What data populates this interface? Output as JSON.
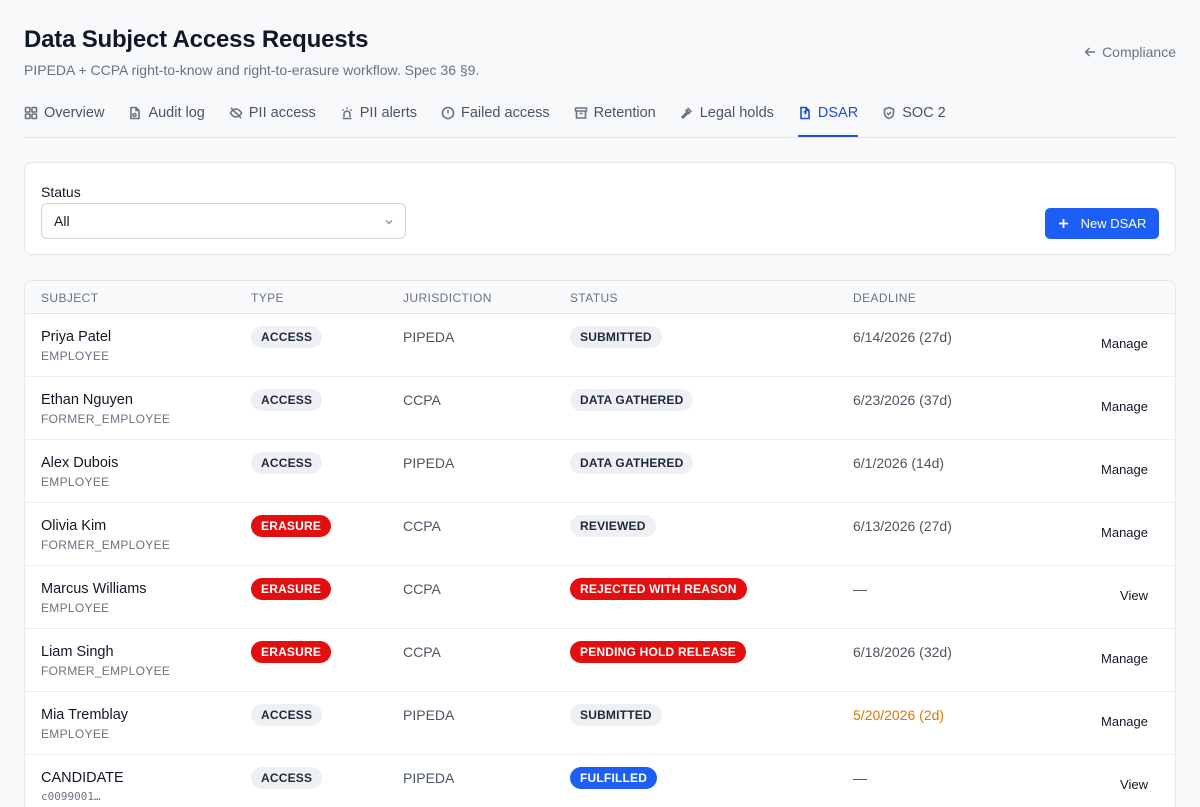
{
  "header": {
    "title": "Data Subject Access Requests",
    "subtitle": "PIPEDA + CCPA right-to-know and right-to-erasure workflow. Spec 36 §9.",
    "back_label": "Compliance"
  },
  "tabs": [
    {
      "label": "Overview",
      "icon": "grid-icon"
    },
    {
      "label": "Audit log",
      "icon": "file-icon"
    },
    {
      "label": "PII access",
      "icon": "eye-off-icon"
    },
    {
      "label": "PII alerts",
      "icon": "siren-icon"
    },
    {
      "label": "Failed access",
      "icon": "alert-circle-icon"
    },
    {
      "label": "Retention",
      "icon": "archive-icon"
    },
    {
      "label": "Legal holds",
      "icon": "gavel-icon"
    },
    {
      "label": "DSAR",
      "icon": "document-icon"
    },
    {
      "label": "SOC 2",
      "icon": "shield-icon"
    }
  ],
  "active_tab": "DSAR",
  "filter": {
    "status_label": "Status",
    "status_value": "All",
    "new_button": "New DSAR"
  },
  "table": {
    "columns": [
      "SUBJECT",
      "TYPE",
      "JURISDICTION",
      "STATUS",
      "DEADLINE"
    ],
    "rows": [
      {
        "name": "Priya Patel",
        "kind": "EMPLOYEE",
        "type": "ACCESS",
        "jurisdiction": "PIPEDA",
        "status": "SUBMITTED",
        "deadline": "6/14/2026 (27d)",
        "action": "Manage"
      },
      {
        "name": "Ethan Nguyen",
        "kind": "FORMER_EMPLOYEE",
        "type": "ACCESS",
        "jurisdiction": "CCPA",
        "status": "DATA GATHERED",
        "deadline": "6/23/2026 (37d)",
        "action": "Manage"
      },
      {
        "name": "Alex Dubois",
        "kind": "EMPLOYEE",
        "type": "ACCESS",
        "jurisdiction": "PIPEDA",
        "status": "DATA GATHERED",
        "deadline": "6/1/2026 (14d)",
        "action": "Manage"
      },
      {
        "name": "Olivia Kim",
        "kind": "FORMER_EMPLOYEE",
        "type": "ERASURE",
        "jurisdiction": "CCPA",
        "status": "REVIEWED",
        "deadline": "6/13/2026 (27d)",
        "action": "Manage"
      },
      {
        "name": "Marcus Williams",
        "kind": "EMPLOYEE",
        "type": "ERASURE",
        "jurisdiction": "CCPA",
        "status": "REJECTED WITH REASON",
        "deadline": "—",
        "action": "View"
      },
      {
        "name": "Liam Singh",
        "kind": "FORMER_EMPLOYEE",
        "type": "ERASURE",
        "jurisdiction": "CCPA",
        "status": "PENDING HOLD RELEASE",
        "deadline": "6/18/2026 (32d)",
        "action": "Manage"
      },
      {
        "name": "Mia Tremblay",
        "kind": "EMPLOYEE",
        "type": "ACCESS",
        "jurisdiction": "PIPEDA",
        "status": "SUBMITTED",
        "deadline": "5/20/2026 (2d)",
        "action": "Manage"
      },
      {
        "name": "CANDIDATE",
        "kind": "c0099001…",
        "type": "ACCESS",
        "jurisdiction": "PIPEDA",
        "status": "FULFILLED",
        "deadline": "—",
        "action": "View"
      }
    ]
  },
  "colors": {
    "accent": "#1d5ff5",
    "erasure_badge": "#e10f0f",
    "neutral_badge": "#eef0f3",
    "urgent_deadline": "#d97706"
  }
}
